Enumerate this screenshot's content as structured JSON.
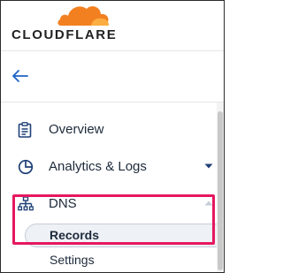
{
  "brand": {
    "name": "CLOUDFLARE",
    "logo_icon": "cloud-icon",
    "logo_color": "#f38020"
  },
  "back": {
    "icon": "arrow-left-icon"
  },
  "nav": {
    "items": [
      {
        "label": "Overview",
        "icon": "clipboard-icon"
      },
      {
        "label": "Analytics & Logs",
        "icon": "pie-chart-icon"
      },
      {
        "label": "DNS",
        "icon": "network-icon"
      }
    ],
    "dns_subitems": [
      {
        "label": "Records",
        "selected": true
      },
      {
        "label": "Settings",
        "selected": false
      }
    ]
  },
  "highlight_color": "#e6185f"
}
